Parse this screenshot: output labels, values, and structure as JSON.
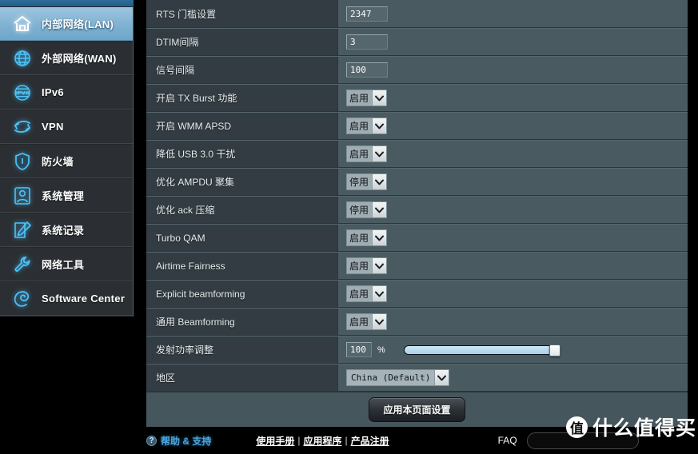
{
  "sidebar": {
    "items": [
      {
        "label": "内部网络(LAN)",
        "icon": "home-icon",
        "active": true
      },
      {
        "label": "外部网络(WAN)",
        "icon": "globe-icon",
        "active": false
      },
      {
        "label": "IPv6",
        "icon": "ipv6-globe-icon",
        "active": false
      },
      {
        "label": "VPN",
        "icon": "vpn-arrows-icon",
        "active": false
      },
      {
        "label": "防火墙",
        "icon": "shield-icon",
        "active": false
      },
      {
        "label": "系统管理",
        "icon": "user-icon",
        "active": false
      },
      {
        "label": "系统记录",
        "icon": "notepad-pencil-icon",
        "active": false
      },
      {
        "label": "网络工具",
        "icon": "wrench-icon",
        "active": false
      },
      {
        "label": "Software Center",
        "icon": "spiral-icon",
        "active": false
      }
    ]
  },
  "settings": {
    "rows": [
      {
        "label": "RTS 门槛设置",
        "type": "text",
        "value": "2347"
      },
      {
        "label": "DTIM间隔",
        "type": "text",
        "value": "3"
      },
      {
        "label": "信号间隔",
        "type": "text",
        "value": "100"
      },
      {
        "label": "开启 TX Burst 功能",
        "type": "select",
        "value": "启用"
      },
      {
        "label": "开启 WMM APSD",
        "type": "select",
        "value": "启用"
      },
      {
        "label": "降低 USB 3.0 干扰",
        "type": "select",
        "value": "启用"
      },
      {
        "label": "优化 AMPDU 聚集",
        "type": "select",
        "value": "停用"
      },
      {
        "label": "优化 ack 压缩",
        "type": "select",
        "value": "停用"
      },
      {
        "label": "Turbo QAM",
        "type": "select",
        "value": "启用"
      },
      {
        "label": "Airtime Fairness",
        "type": "select",
        "value": "启用"
      },
      {
        "label": "Explicit beamforming",
        "type": "select",
        "value": "启用"
      },
      {
        "label": "通用 Beamforming",
        "type": "select",
        "value": "启用"
      },
      {
        "label": "发射功率调整",
        "type": "slider",
        "value": "100",
        "unit": "%",
        "percent": 100
      },
      {
        "label": "地区",
        "type": "select-wide",
        "value": "China (Default)"
      }
    ]
  },
  "apply": {
    "label": "应用本页面设置"
  },
  "footer": {
    "help_icon": "?",
    "help_label": "帮助 & 支持",
    "links": [
      {
        "label": "使用手册"
      },
      {
        "label": "应用程序"
      },
      {
        "label": "产品注册"
      }
    ],
    "separator": "|",
    "faq_label": "FAQ",
    "search_placeholder": ""
  },
  "watermark": {
    "logo": "值",
    "text": "什么值得买"
  }
}
